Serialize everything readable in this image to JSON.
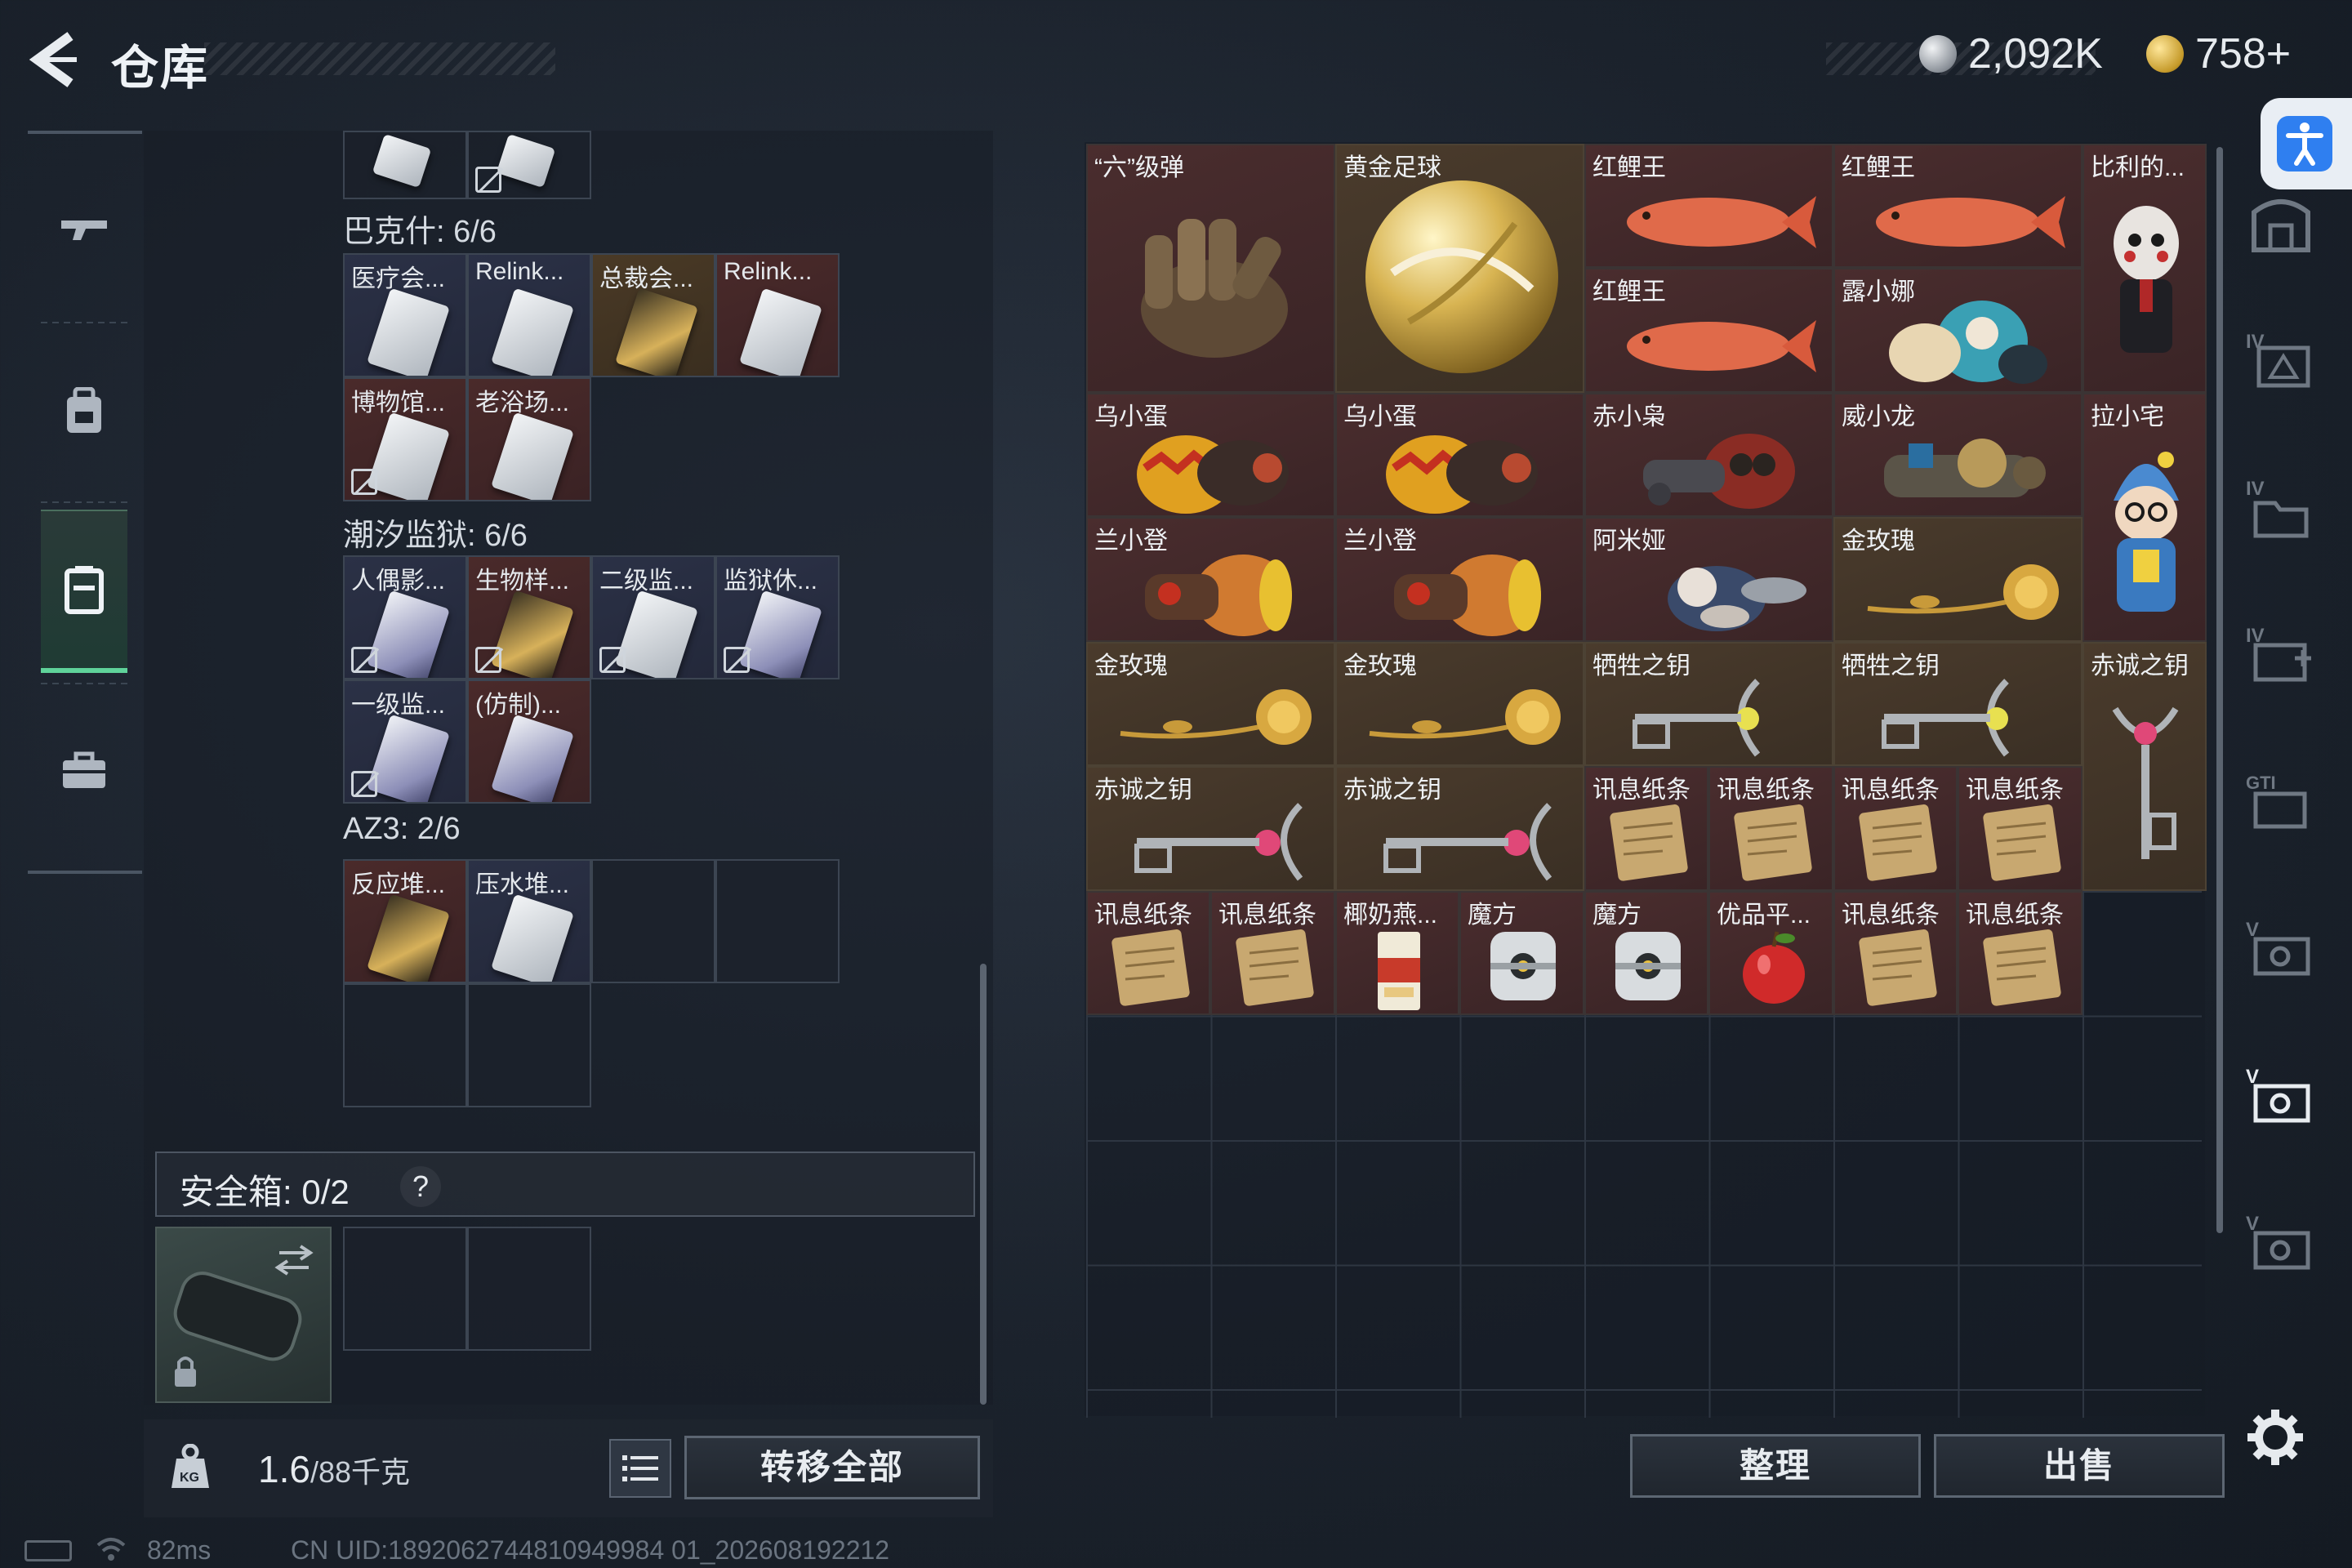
{
  "header": {
    "title": "仓库",
    "currency_a": "2,092K",
    "currency_b": "758+"
  },
  "left_nav": {
    "items": [
      {
        "name": "weapon-icon"
      },
      {
        "name": "backpack-icon"
      },
      {
        "name": "container-icon",
        "active": true
      },
      {
        "name": "toolbox-icon"
      }
    ]
  },
  "key_groups": [
    {
      "label": "巴克什: 6/6",
      "items": [
        "医疗会...",
        "Relink...",
        "总裁会...",
        "Relink...",
        "博物馆...",
        "老浴场..."
      ]
    },
    {
      "label": "潮汐监狱: 6/6",
      "items": [
        "人偶影...",
        "生物样...",
        "二级监...",
        "监狱休...",
        "一级监...",
        "(仿制)..."
      ]
    },
    {
      "label": "AZ3: 2/6",
      "items": [
        "反应堆...",
        "压水堆..."
      ]
    }
  ],
  "safebox": {
    "label": "安全箱: 0/2",
    "help": "?"
  },
  "bottom_left": {
    "weight_value": "1.6",
    "weight_unit": "/88千克",
    "transfer_all": "转移全部"
  },
  "footer": {
    "ping": "82ms",
    "uid": "CN UID:1892062744810949984 01_202608192212"
  },
  "storage_items": [
    {
      "label": "“六”级弹"
    },
    {
      "label": "黄金足球"
    },
    {
      "label": "红鲤王"
    },
    {
      "label": "红鲤王"
    },
    {
      "label": "比利的..."
    },
    {
      "label": "红鲤王"
    },
    {
      "label": "露小娜"
    },
    {
      "label": "乌小蛋"
    },
    {
      "label": "乌小蛋"
    },
    {
      "label": "赤小枭"
    },
    {
      "label": "威小龙"
    },
    {
      "label": "拉小宅"
    },
    {
      "label": "兰小登"
    },
    {
      "label": "兰小登"
    },
    {
      "label": "阿米娅"
    },
    {
      "label": "金玫瑰"
    },
    {
      "label": "金玫瑰"
    },
    {
      "label": "金玫瑰"
    },
    {
      "label": "牺牲之钥"
    },
    {
      "label": "牺牲之钥"
    },
    {
      "label": "赤诚之钥"
    },
    {
      "label": "赤诚之钥"
    },
    {
      "label": "赤诚之钥"
    },
    {
      "label": "讯息纸条"
    },
    {
      "label": "讯息纸条"
    },
    {
      "label": "讯息纸条"
    },
    {
      "label": "讯息纸条"
    },
    {
      "label": "讯息纸条"
    },
    {
      "label": "讯息纸条"
    },
    {
      "label": "椰奶燕..."
    },
    {
      "label": "魔方"
    },
    {
      "label": "魔方"
    },
    {
      "label": "优品平..."
    },
    {
      "label": "讯息纸条"
    },
    {
      "label": "讯息纸条"
    }
  ],
  "right_buttons": {
    "sort": "整理",
    "sell": "出售"
  },
  "colors": {
    "accent_green": "#5fd39a",
    "item_red": "#4a2d2e",
    "item_navy": "#2b3146",
    "item_gold": "#4a3b2c"
  }
}
